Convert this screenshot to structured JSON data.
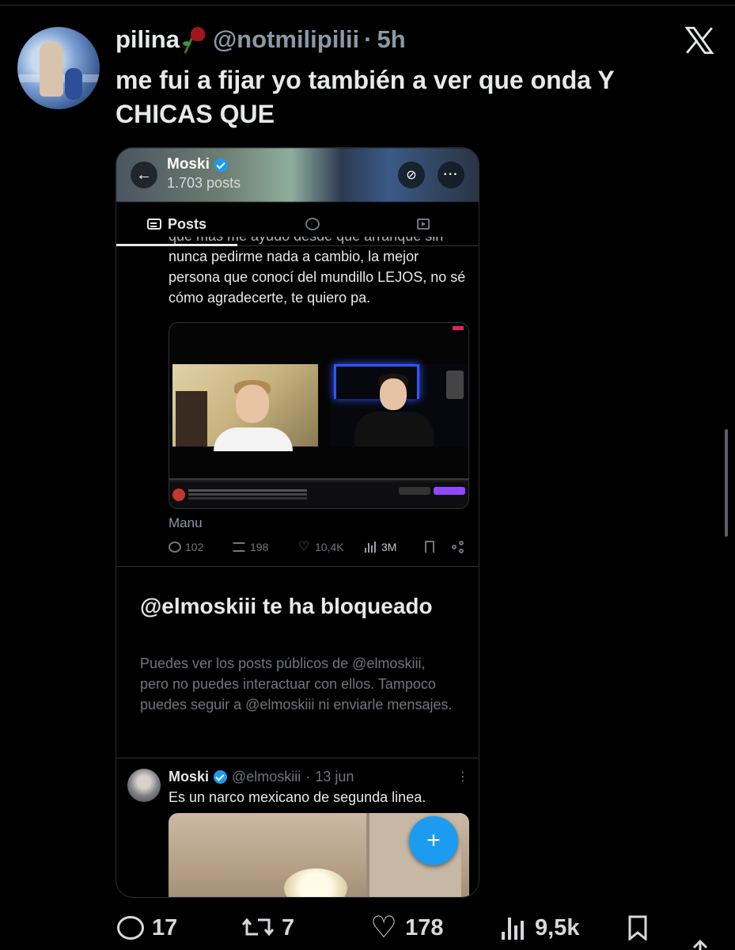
{
  "tweet": {
    "display_name": "pilina",
    "handle": "@notmilipilii",
    "separator": "·",
    "age": "5h",
    "text": "me fui a fijar yo también a ver que onda Y CHICAS QUE"
  },
  "screenshot": {
    "profile_name": "Moski",
    "post_count": "1.703 posts",
    "tabs": [
      {
        "label": "Posts",
        "icon": "posts-icon",
        "active": true
      },
      {
        "label": "",
        "icon": "replies-icon",
        "active": false
      },
      {
        "label": "",
        "icon": "media-icon",
        "active": false
      }
    ],
    "post1": {
      "cut_line": "que más me ayudó desde que arranqué sin",
      "text": "nunca pedirme nada a cambio, la mejor persona que conocí del mundillo LEJOS, no sé cómo agradecerte, te quiero pa.",
      "caption": "Manu",
      "replies": "102",
      "reposts": "198",
      "likes": "10,4K",
      "views": "3M"
    },
    "blocked": {
      "title": "@elmoskiii te ha bloqueado",
      "text": "Puedes ver los posts públicos de @elmoskiii, pero no puedes interactuar con ellos. Tampoco puedes seguir a @elmoskiii ni enviarle mensajes."
    },
    "post2": {
      "name": "Moski",
      "handle": "@elmoskiii",
      "separator": "·",
      "date": "13 jun",
      "more": "⋮",
      "text": "Es un narco mexicano de segunda linea."
    },
    "fab_label": "+"
  },
  "actions": {
    "replies": "17",
    "reposts": "7",
    "likes": "178",
    "views": "9,5k"
  },
  "colors": {
    "background": "#000000",
    "accent": "#1d9bf0",
    "muted": "#71767b",
    "text": "#e7e9ea"
  }
}
